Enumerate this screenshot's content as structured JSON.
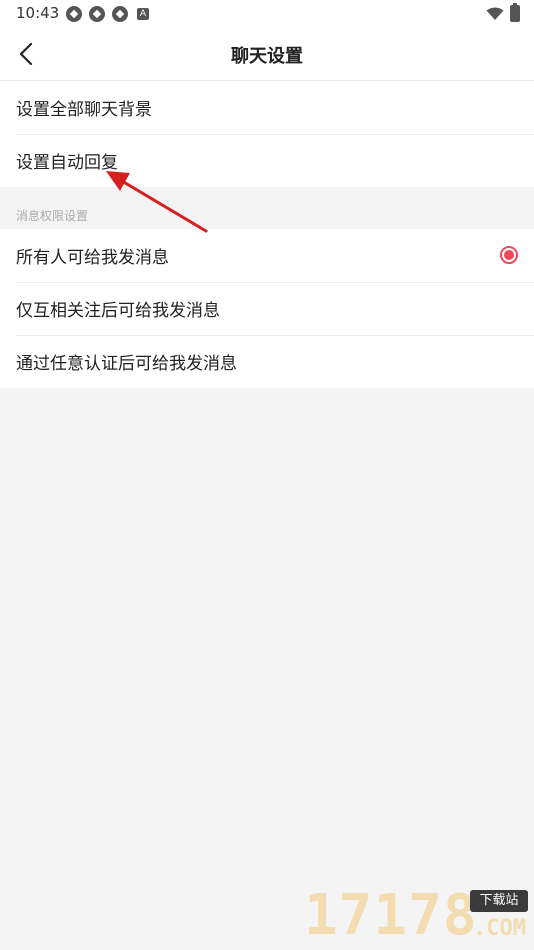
{
  "status_bar": {
    "time": "10:43",
    "notification_icons": [
      "aperture-icon",
      "aperture-icon",
      "aperture-icon",
      "a-badge-icon"
    ],
    "badge_letter": "A"
  },
  "header": {
    "title": "聊天设置"
  },
  "settings_group": {
    "items": [
      {
        "label": "设置全部聊天背景"
      },
      {
        "label": "设置自动回复"
      }
    ]
  },
  "permissions": {
    "section_title": "消息权限设置",
    "options": [
      {
        "label": "所有人可给我发消息",
        "selected": true
      },
      {
        "label": "仅互相关注后可给我发消息",
        "selected": false
      },
      {
        "label": "通过任意认证后可给我发消息",
        "selected": false
      }
    ]
  },
  "watermark": {
    "digits": "17178",
    "badge": "下载站",
    "suffix": ".COM"
  },
  "colors": {
    "accent": "#f0475a",
    "annotation_arrow": "#d62020",
    "background": "#f4f4f4"
  }
}
